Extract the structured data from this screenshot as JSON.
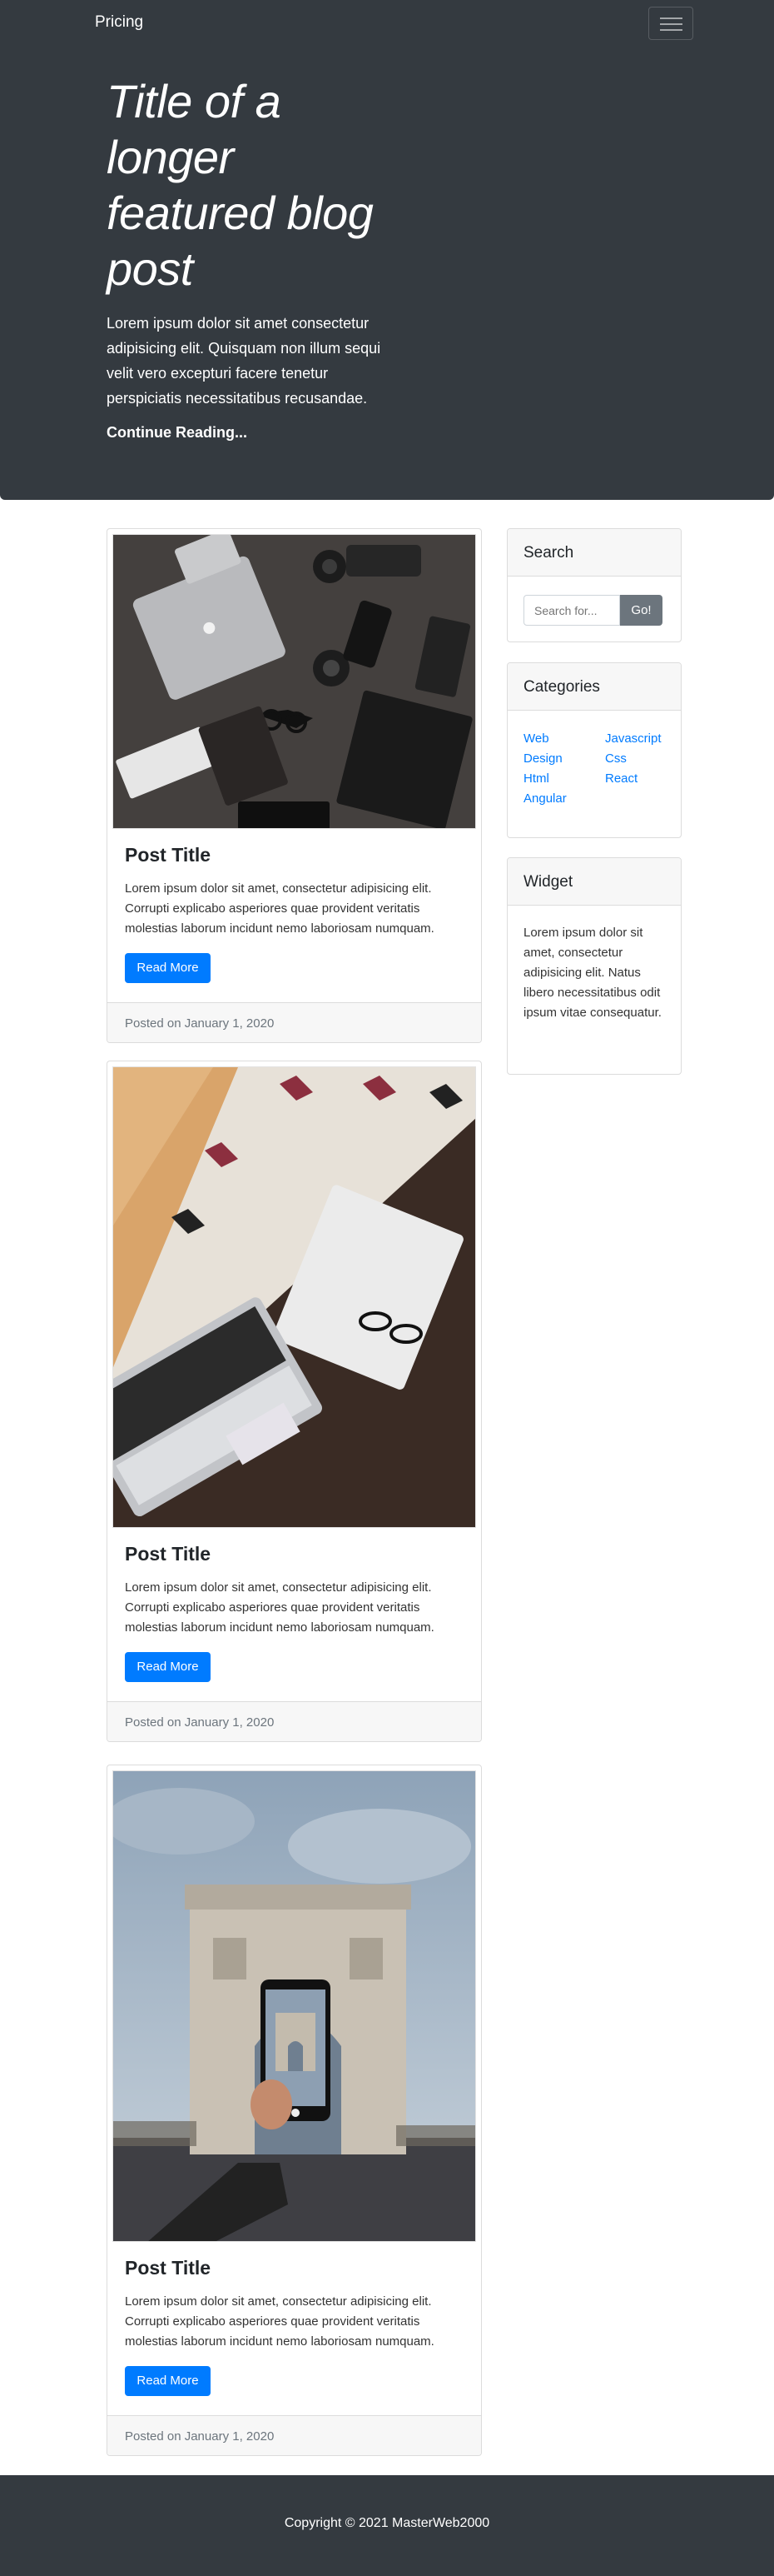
{
  "navbar": {
    "brand": "Pricing",
    "toggle_icon": "hamburger-icon"
  },
  "hero": {
    "title": "Title of a longer featured blog post",
    "text": "Lorem ipsum dolor sit amet consectetur adipisicing elit. Quisquam non illum sequi velit vero excepturi facere tenetur perspiciatis necessitatibus recusandae.",
    "link": "Continue Reading..."
  },
  "posts": [
    {
      "title": "Post Title",
      "text": "Lorem ipsum dolor sit amet, consectetur adipisicing elit. Corrupti explicabo asperiores quae provident veritatis molestias laborum incidunt nemo laboriosam numquam.",
      "button": "Read More",
      "footer": "Posted on January 1, 2020"
    },
    {
      "title": "Post Title",
      "text": "Lorem ipsum dolor sit amet, consectetur adipisicing elit. Corrupti explicabo asperiores quae provident veritatis molestias laborum incidunt nemo laboriosam numquam.",
      "button": "Read More",
      "footer": "Posted on January 1, 2020"
    },
    {
      "title": "Post Title",
      "text": "Lorem ipsum dolor sit amet, consectetur adipisicing elit. Corrupti explicabo asperiores quae provident veritatis molestias laborum incidunt nemo laboriosam numquam.",
      "button": "Read More",
      "footer": "Posted on January 1, 2020"
    }
  ],
  "sidebar": {
    "search": {
      "title": "Search",
      "placeholder": "Search for...",
      "button": "Go!"
    },
    "categories": {
      "title": "Categories",
      "left": [
        "Web",
        "Design",
        "Html",
        "Angular"
      ],
      "right": [
        "Javascript",
        "Css",
        "React"
      ]
    },
    "widget": {
      "title": "Widget",
      "text": "Lorem ipsum dolor sit amet, consectetur adipisicing elit. Natus libero necessitatibus odit ipsum vitae consequatur."
    }
  },
  "footer": {
    "text": "Copyright © 2021 MasterWeb2000"
  },
  "colors": {
    "dark": "#343a40",
    "primary": "#007bff",
    "secondary": "#6c757d",
    "light": "#f7f7f7"
  }
}
